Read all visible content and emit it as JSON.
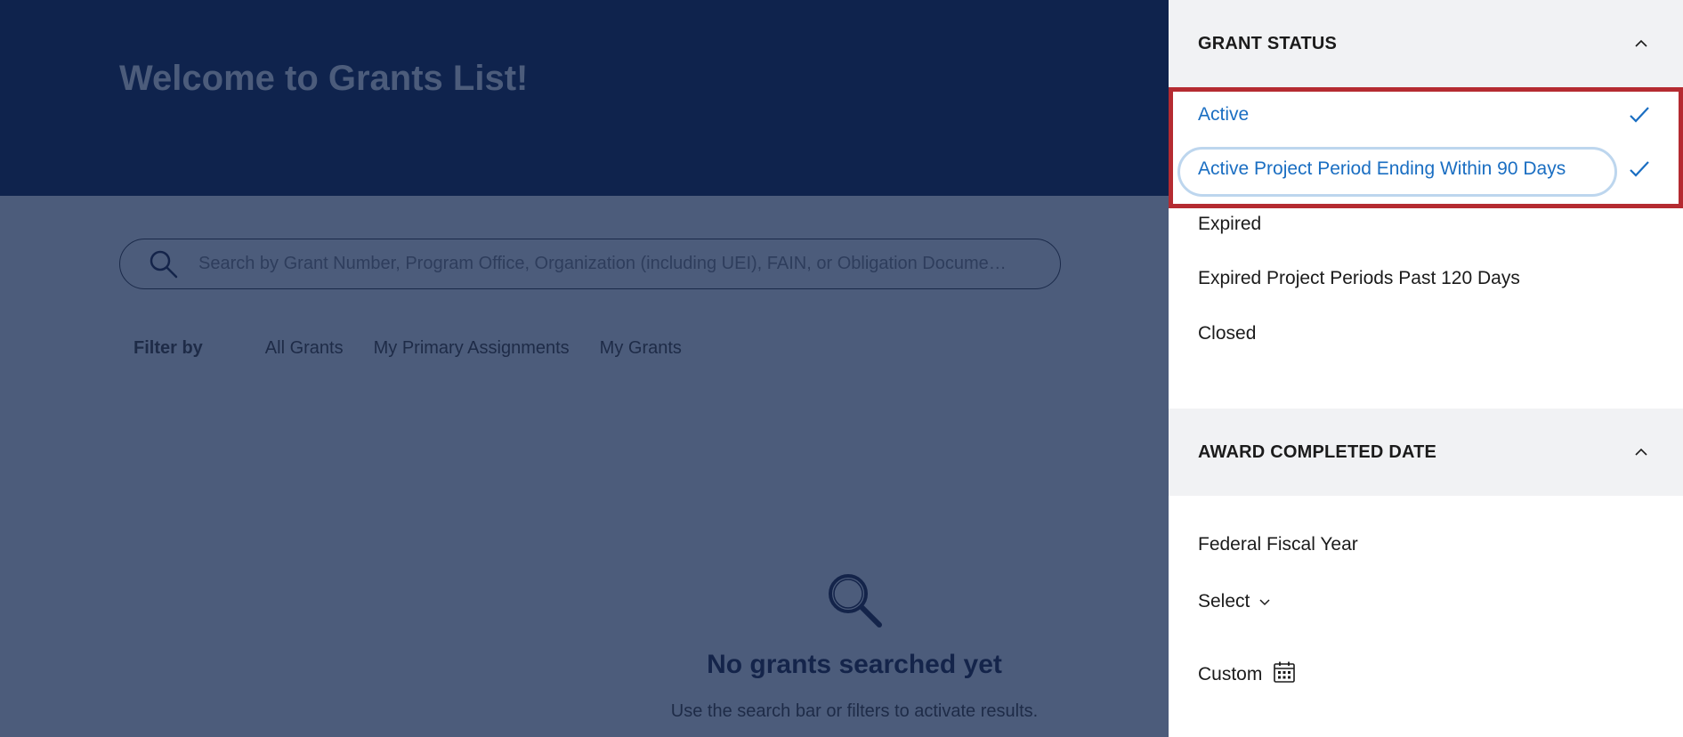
{
  "page": {
    "title": "Welcome to Grants List!"
  },
  "search": {
    "placeholder": "Search by Grant Number, Program Office, Organization (including UEI), FAIN, or Obligation Docume…",
    "icon": "search-icon"
  },
  "filters": {
    "label": "Filter by",
    "options": [
      "All Grants",
      "My Primary Assignments",
      "My Grants"
    ]
  },
  "empty_state": {
    "icon": "magnifier-icon",
    "title": "No grants searched yet",
    "subtitle": "Use the search bar or filters to activate results."
  },
  "panel": {
    "grant_status": {
      "title": "GRANT STATUS",
      "items": [
        {
          "label": "Active",
          "selected": true
        },
        {
          "label": "Active Project Period Ending Within 90 Days",
          "selected": true
        },
        {
          "label": "Expired",
          "selected": false
        },
        {
          "label": "Expired Project Periods Past 120 Days",
          "selected": false
        },
        {
          "label": "Closed",
          "selected": false
        }
      ]
    },
    "award_completed_date": {
      "title": "AWARD COMPLETED DATE",
      "fiscal_year_label": "Federal Fiscal Year",
      "select_label": "Select",
      "custom_label": "Custom"
    }
  },
  "colors": {
    "header_bg": "#0f234d",
    "overlay_bg": "#4c5c7b",
    "selected_text": "#1a6ec2",
    "highlight": "#b52b31"
  }
}
